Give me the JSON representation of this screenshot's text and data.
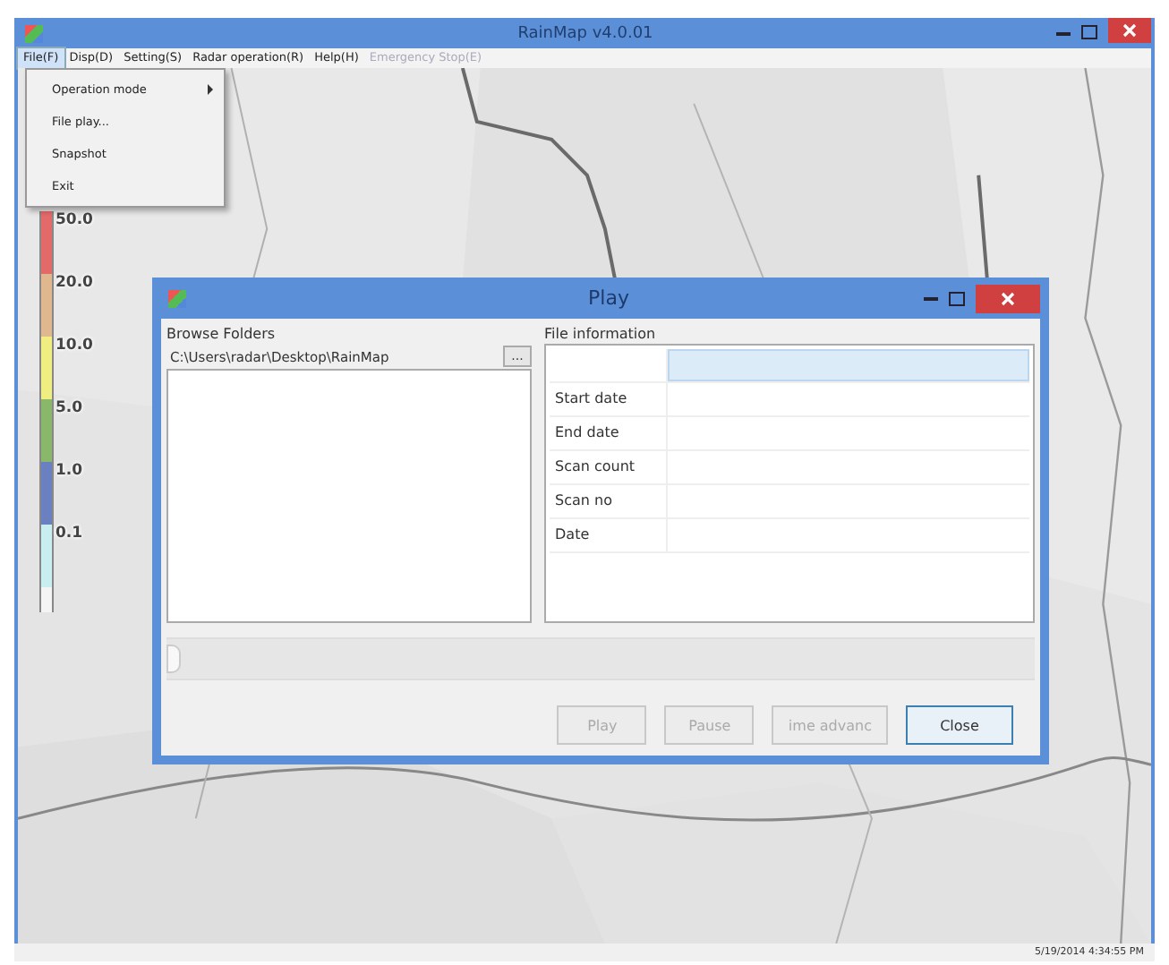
{
  "window": {
    "title": "RainMap v4.0.01"
  },
  "menu_bar": [
    {
      "label": "File(F)",
      "selected": true,
      "disabled": false
    },
    {
      "label": "Disp(D)",
      "selected": false,
      "disabled": false
    },
    {
      "label": "Setting(S)",
      "selected": false,
      "disabled": false
    },
    {
      "label": "Radar operation(R)",
      "selected": false,
      "disabled": false
    },
    {
      "label": "Help(H)",
      "selected": false,
      "disabled": false
    },
    {
      "label": "Emergency Stop(E)",
      "selected": false,
      "disabled": true
    }
  ],
  "file_menu": [
    {
      "label": "Operation mode",
      "submenu": true
    },
    {
      "label": "File play...",
      "submenu": false
    },
    {
      "label": "Snapshot",
      "submenu": false
    },
    {
      "label": "Exit",
      "submenu": false
    }
  ],
  "legend": [
    {
      "label": "50.0",
      "color": "#e46a6a"
    },
    {
      "label": "20.0",
      "color": "#e0b890"
    },
    {
      "label": "10.0",
      "color": "#f0ee80"
    },
    {
      "label": "5.0",
      "color": "#8ab86a"
    },
    {
      "label": "1.0",
      "color": "#6a80c0"
    },
    {
      "label": "0.1",
      "color": "#c8eef0"
    }
  ],
  "dialog": {
    "title": "Play",
    "browse_label": "Browse Folders",
    "path": "C:\\Users\\radar\\Desktop\\RainMap",
    "browse_button": "...",
    "info_label": "File information",
    "info_rows": [
      {
        "label": "Start date"
      },
      {
        "label": "End date"
      },
      {
        "label": "Scan count"
      },
      {
        "label": "Scan no"
      },
      {
        "label": "Date"
      }
    ],
    "slider": {
      "level": 0
    },
    "buttons": [
      {
        "label": "Play",
        "disabled": true,
        "default": false
      },
      {
        "label": "Pause",
        "disabled": true,
        "default": false
      },
      {
        "label": "ime advanc",
        "disabled": true,
        "default": false
      },
      {
        "label": "Close",
        "disabled": false,
        "default": true
      }
    ]
  },
  "status_bar": {
    "time": "5/19/2014 4:34:55 PM"
  }
}
